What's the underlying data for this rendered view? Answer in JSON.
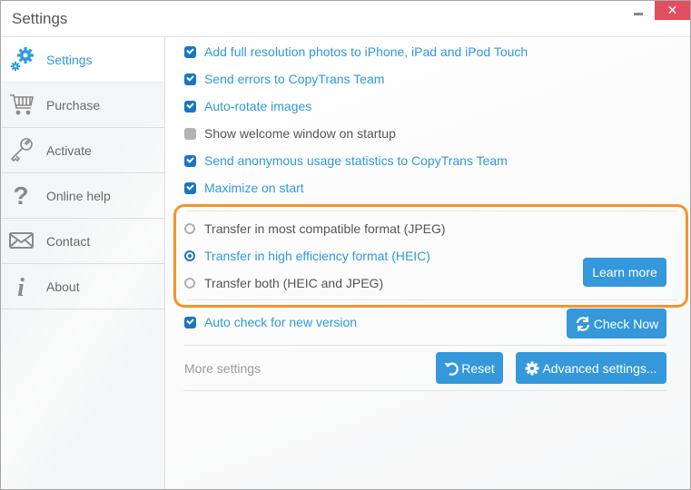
{
  "window": {
    "title": "Settings",
    "close_glyph": "✕"
  },
  "sidebar": {
    "items": [
      {
        "label": "Settings",
        "icon": "gears-icon",
        "active": true
      },
      {
        "label": "Purchase",
        "icon": "cart-icon",
        "active": false
      },
      {
        "label": "Activate",
        "icon": "key-icon",
        "active": false
      },
      {
        "label": "Online help",
        "icon": "question-icon",
        "active": false
      },
      {
        "label": "Contact",
        "icon": "envelope-icon",
        "active": false
      },
      {
        "label": "About",
        "icon": "info-icon",
        "active": false
      }
    ]
  },
  "settings": {
    "checkboxes": [
      {
        "label": "Add full resolution photos to iPhone, iPad and iPod Touch",
        "checked": true
      },
      {
        "label": "Send errors to CopyTrans Team",
        "checked": true
      },
      {
        "label": "Auto-rotate images",
        "checked": true
      },
      {
        "label": "Show welcome window on startup",
        "checked": false
      },
      {
        "label": "Send anonymous usage statistics to CopyTrans Team",
        "checked": true
      },
      {
        "label": "Maximize on start",
        "checked": true
      }
    ],
    "format": {
      "options": [
        {
          "label": "Transfer in most compatible format (JPEG)",
          "selected": false
        },
        {
          "label": "Transfer in high efficiency format (HEIC)",
          "selected": true
        },
        {
          "label": "Transfer both (HEIC and JPEG)",
          "selected": false
        }
      ],
      "learn_more_label": "Learn more",
      "highlight_color": "#f7932b"
    },
    "auto_check": {
      "label": "Auto check for new version",
      "checked": true
    },
    "check_now_label": "Check Now",
    "more_settings_label": "More settings",
    "reset_label": "Reset",
    "advanced_label": "Advanced settings..."
  },
  "colors": {
    "accent": "#3498db",
    "active_text": "#2f9ad8",
    "checkbox": "#1a76c2",
    "close_button": "#e04f5f"
  }
}
